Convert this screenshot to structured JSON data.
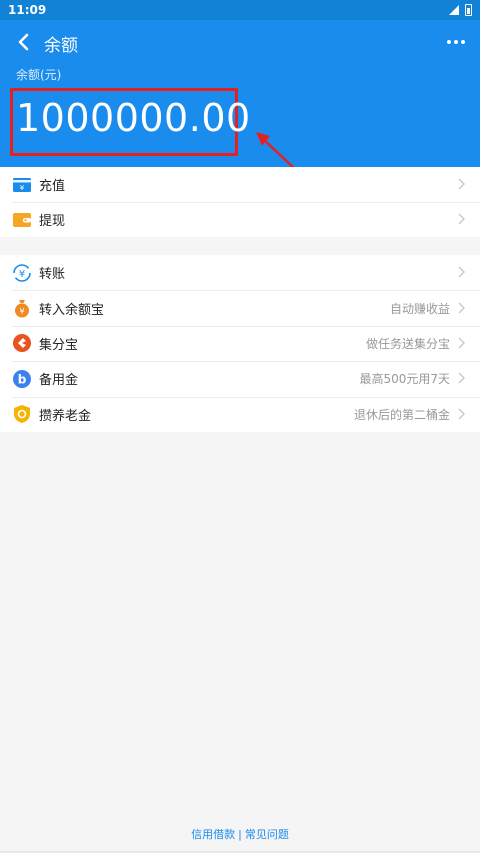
{
  "status_bar": {
    "time": "11:09"
  },
  "nav": {
    "title": "余额"
  },
  "balance": {
    "label": "余额(元)",
    "amount": "1000000.00"
  },
  "group1": [
    {
      "label": "充值",
      "icon": "recharge-icon"
    },
    {
      "label": "提现",
      "icon": "wallet-icon"
    }
  ],
  "group2": [
    {
      "label": "转账",
      "sub": "",
      "icon": "transfer-icon"
    },
    {
      "label": "转入余额宝",
      "sub": "自动赚收益",
      "icon": "money-bag-icon"
    },
    {
      "label": "集分宝",
      "sub": "做任务送集分宝",
      "icon": "jifenbao-icon"
    },
    {
      "label": "备用金",
      "sub": "最高500元用7天",
      "icon": "reserve-fund-icon"
    },
    {
      "label": "攒养老金",
      "sub": "退休后的第二桶金",
      "icon": "pension-icon"
    }
  ],
  "footer": {
    "link1": "信用借款",
    "link2": "常见问题"
  },
  "colors": {
    "header": "#1a8cee",
    "highlight": "#e42020"
  }
}
